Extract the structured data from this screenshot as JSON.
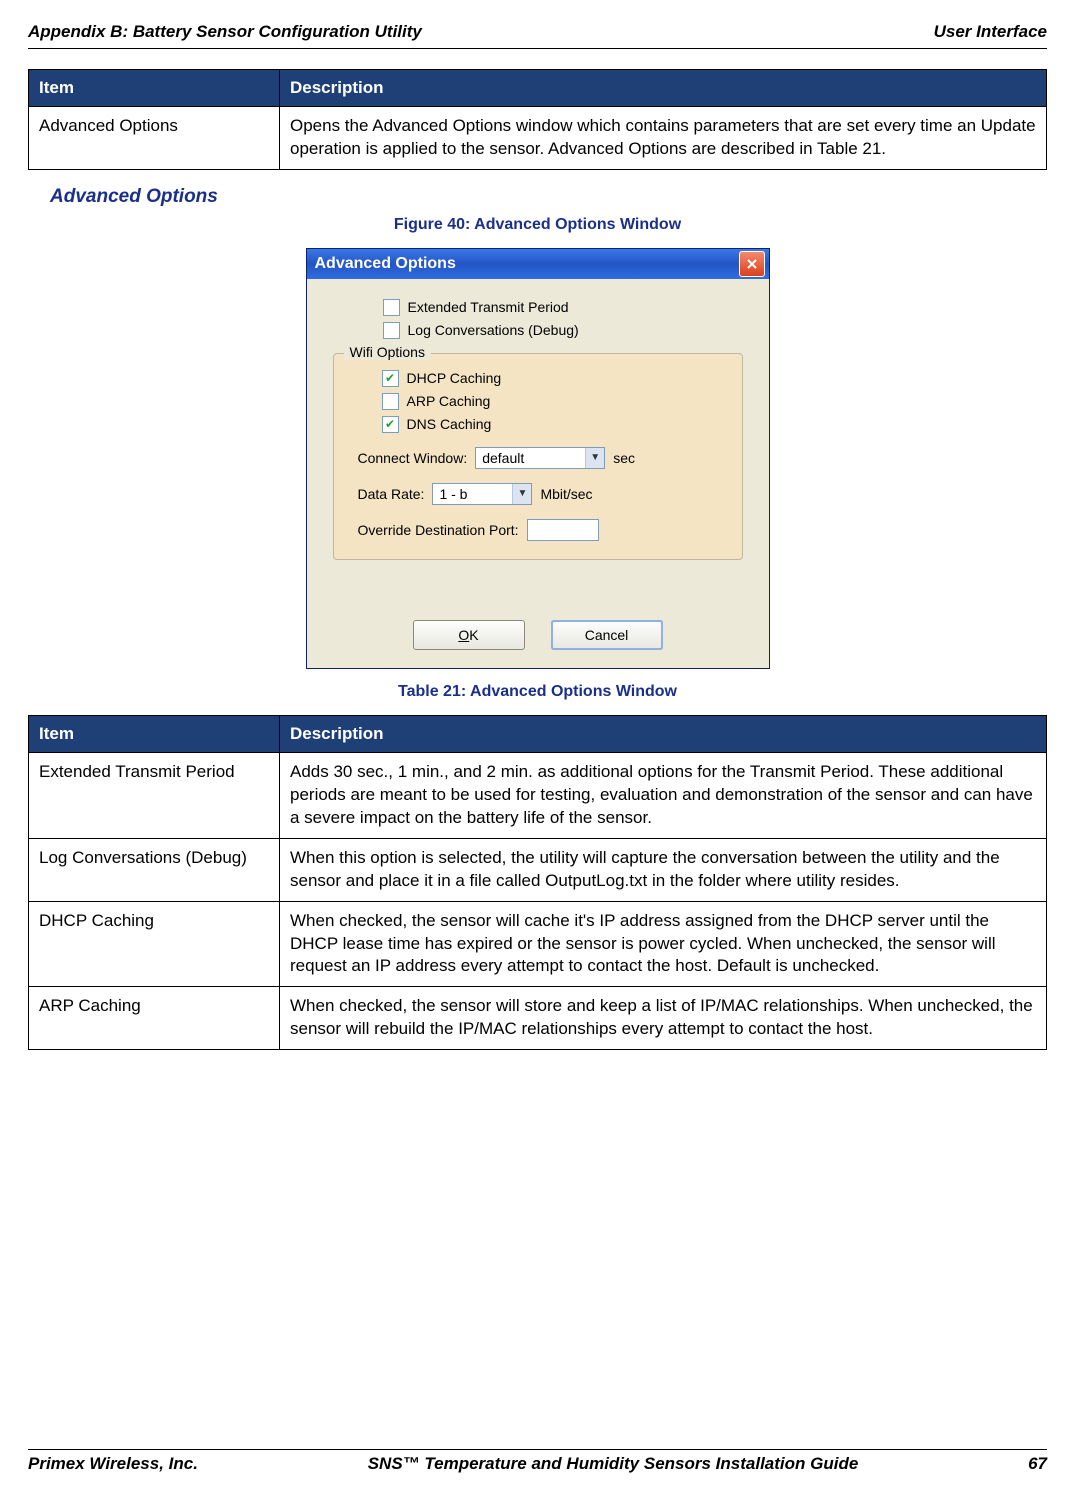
{
  "header": {
    "left": "Appendix B: Battery Sensor Configuration Utility",
    "right": "User Interface"
  },
  "table20": {
    "head_item": "Item",
    "head_desc": "Description",
    "rows": [
      {
        "item": "Advanced Options",
        "desc": "Opens the Advanced Options window which contains parameters that are set every time an Update operation is applied to the sensor. Advanced Options are described in Table 21."
      }
    ]
  },
  "section_heading": "Advanced Options",
  "figure_caption": "Figure 40: Advanced Options Window",
  "window": {
    "title": "Advanced Options",
    "chk_extended": {
      "label": "Extended Transmit Period",
      "checked": false
    },
    "chk_log": {
      "label": "Log Conversations (Debug)",
      "checked": false
    },
    "wifi_group_label": "Wifi Options",
    "chk_dhcp": {
      "label": "DHCP Caching",
      "checked": true
    },
    "chk_arp": {
      "label": "ARP Caching",
      "checked": false
    },
    "chk_dns": {
      "label": "DNS Caching",
      "checked": true
    },
    "connect_window": {
      "label": "Connect Window:",
      "value": "default",
      "unit": "sec"
    },
    "data_rate": {
      "label": "Data Rate:",
      "value": "1   - b",
      "unit": "Mbit/sec"
    },
    "override_port": {
      "label": "Override Destination Port:",
      "value": ""
    },
    "btn_ok": "OK",
    "btn_cancel": "Cancel"
  },
  "table21_caption": "Table 21: Advanced Options Window",
  "table21": {
    "head_item": "Item",
    "head_desc": "Description",
    "rows": [
      {
        "item": "Extended Transmit Period",
        "desc": "Adds 30 sec., 1 min., and 2 min. as additional options for the Transmit Period. These additional periods are meant to be used for testing, evaluation and demonstration of the sensor and can have a severe impact on the battery life of the sensor."
      },
      {
        "item": "Log Conversations (Debug)",
        "desc": "When this option is selected, the utility will capture the conversation between the utility and the sensor and place it in a file called OutputLog.txt in the folder where utility resides."
      },
      {
        "item": "DHCP Caching",
        "desc": "When checked, the sensor will cache it's IP address assigned from the DHCP server until the DHCP lease time has expired or the sensor is power cycled. When unchecked, the sensor will request an IP address every attempt to contact the host. Default is unchecked."
      },
      {
        "item": "ARP Caching",
        "desc": "When checked, the sensor will store and keep a list of IP/MAC relationships. When unchecked, the sensor will rebuild the IP/MAC relationships every attempt to contact the host."
      }
    ]
  },
  "footer": {
    "left": "Primex Wireless, Inc.",
    "center": "SNS™ Temperature and Humidity Sensors Installation Guide",
    "right": "67"
  }
}
